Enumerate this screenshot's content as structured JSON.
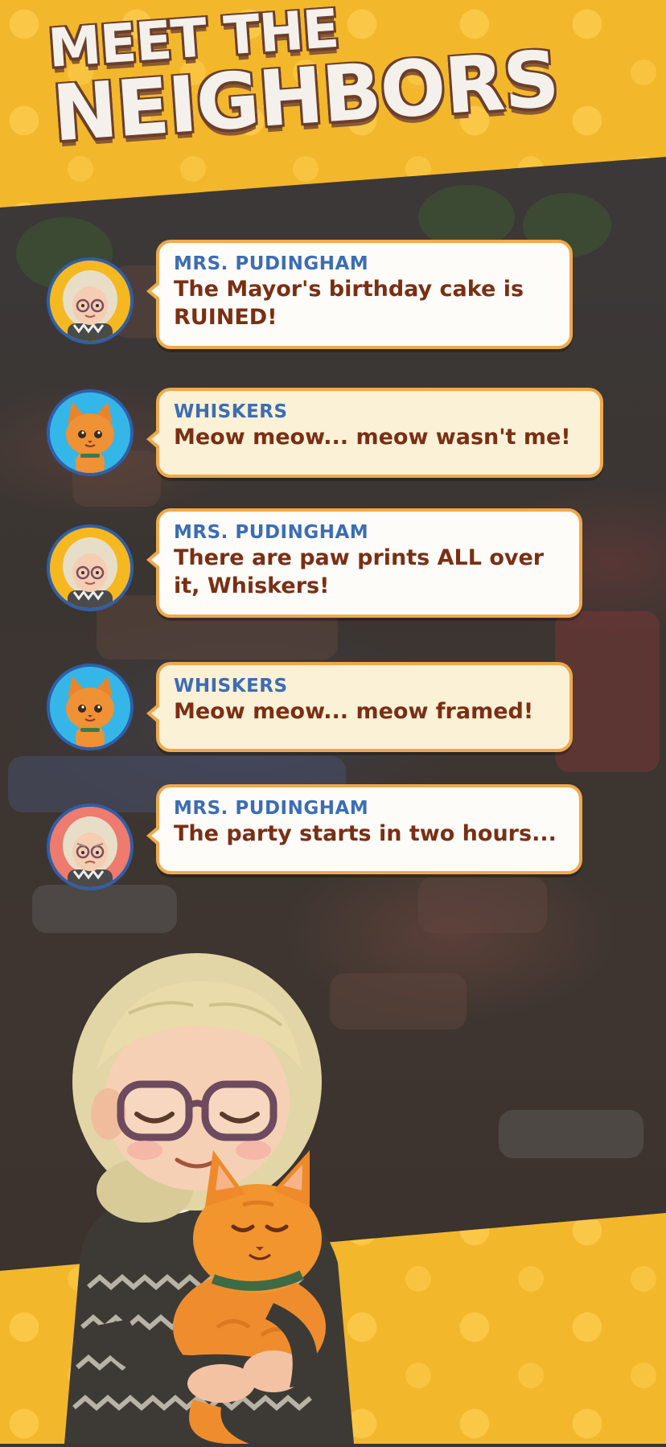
{
  "title": {
    "line1": "MEET THE",
    "line2": "NEIGHBORS"
  },
  "messages": [
    {
      "speaker": "MRS. PUDINGHAM",
      "text": "The Mayor's birthday cake is RUINED!",
      "avatar": "mrs-pudingham-glasses-avatar",
      "avatar_bg": "#f5b820"
    },
    {
      "speaker": "WHISKERS",
      "text": "Meow meow... meow wasn't me!",
      "avatar": "whiskers-cat-avatar",
      "avatar_bg": "#35b6e8"
    },
    {
      "speaker": "MRS. PUDINGHAM",
      "text": "There are paw prints ALL over it, Whiskers!",
      "avatar": "mrs-pudingham-glasses-avatar",
      "avatar_bg": "#f5b820"
    },
    {
      "speaker": "WHISKERS",
      "text": "Meow meow... meow framed!",
      "avatar": "whiskers-cat-avatar",
      "avatar_bg": "#35b6e8"
    },
    {
      "speaker": "MRS. PUDINGHAM",
      "text": "The party starts in two hours...",
      "avatar": "mrs-pudingham-worried-avatar",
      "avatar_bg": "#ef7a6e"
    }
  ],
  "colors": {
    "banner_yellow": "#f3b72c",
    "speaker_blue": "#3c6db5",
    "message_brown": "#7a2f14",
    "bubble_border": "#f0a94a"
  },
  "hero_illustration": "grandma-hugging-orange-cat-illustration"
}
